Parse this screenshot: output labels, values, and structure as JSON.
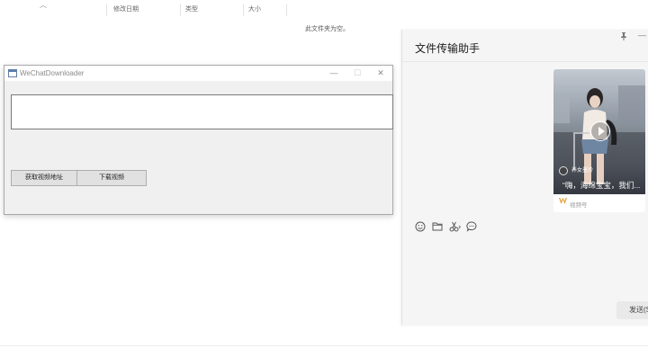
{
  "explorer": {
    "columns": [
      "修改日期",
      "类型",
      "大小"
    ],
    "empty_message": "此文件夹为空。"
  },
  "downloader": {
    "title": "WeChatDownloader",
    "url_value": "",
    "get_button_label": "获取视频地址",
    "download_button_label": "下载视频",
    "minimize_glyph": "—",
    "maximize_glyph": "☐",
    "close_glyph": "✕"
  },
  "file_transfer": {
    "title": "文件传输助手",
    "message_card": {
      "author": "养女墨玲",
      "caption": "“嗨，海绵宝宝，我们...",
      "source_label": "视频号"
    },
    "toolbar_icons": [
      "emoji-icon",
      "folder-icon",
      "scissors-icon",
      "chat-history-icon"
    ],
    "send_button_label": "发送(S)"
  }
}
